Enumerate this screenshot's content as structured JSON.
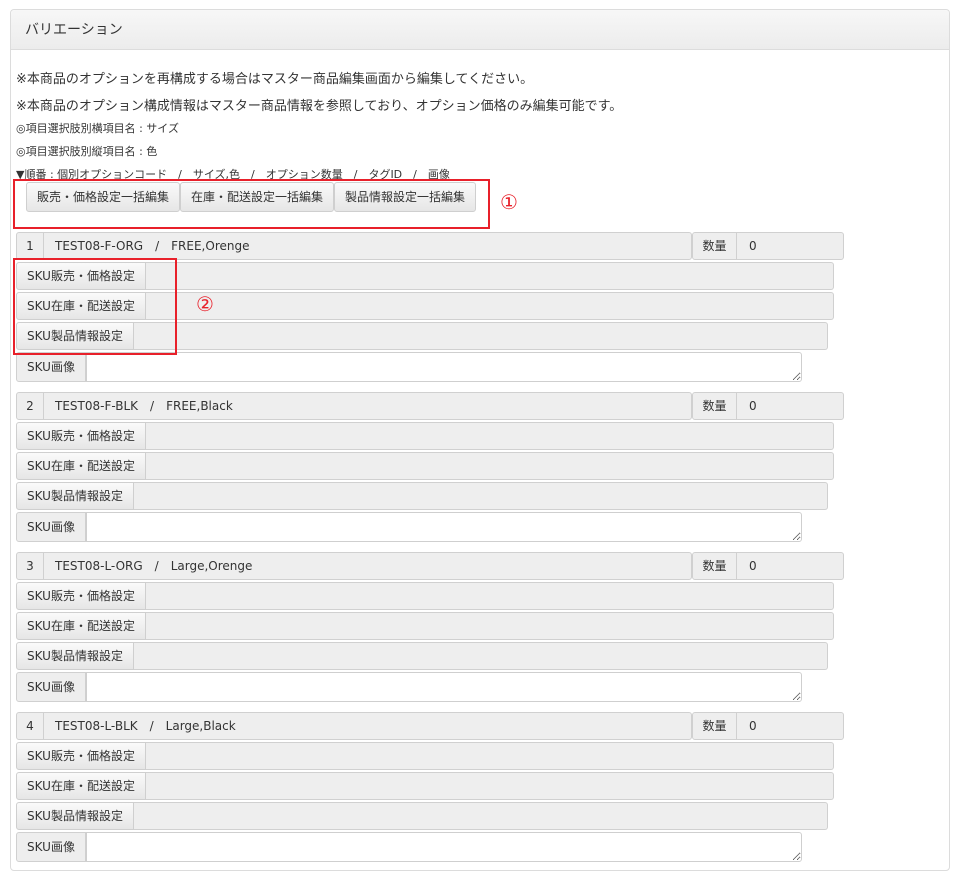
{
  "panel": {
    "title": "バリエーション"
  },
  "notes": {
    "line1": "※本商品のオプションを再構成する場合はマスター商品編集画面から編集してください。",
    "line2": "※本商品のオプション構成情報はマスター商品情報を参照しており、オプション価格のみ編集可能です。",
    "line3": "◎項目選択肢別横項目名 : サイズ",
    "line4": "◎項目選択肢別縦項目名 : 色",
    "line5": "▼順番 : 個別オプションコード　/　サイズ,色　/　オプション数量　/　タグID　/　画像"
  },
  "bulk_buttons": {
    "sales_price": "販売・価格設定一括編集",
    "stock_shipping": "在庫・配送設定一括編集",
    "product_info": "製品情報設定一括編集"
  },
  "annotations": {
    "one": "①",
    "two": "②"
  },
  "labels": {
    "qty": "数量",
    "sku_sales_price": "SKU販売・価格設定",
    "sku_stock_shipping": "SKU在庫・配送設定",
    "sku_product_info": "SKU製品情報設定",
    "sku_image": "SKU画像"
  },
  "skus": [
    {
      "num": "1",
      "code_line": "TEST08-F-ORG　/　FREE,Orenge",
      "qty": "0"
    },
    {
      "num": "2",
      "code_line": "TEST08-F-BLK　/　FREE,Black",
      "qty": "0"
    },
    {
      "num": "3",
      "code_line": "TEST08-L-ORG　/　Large,Orenge",
      "qty": "0"
    },
    {
      "num": "4",
      "code_line": "TEST08-L-BLK　/　Large,Black",
      "qty": "0"
    }
  ],
  "colors": {
    "annotation_red": "#e8202a"
  }
}
